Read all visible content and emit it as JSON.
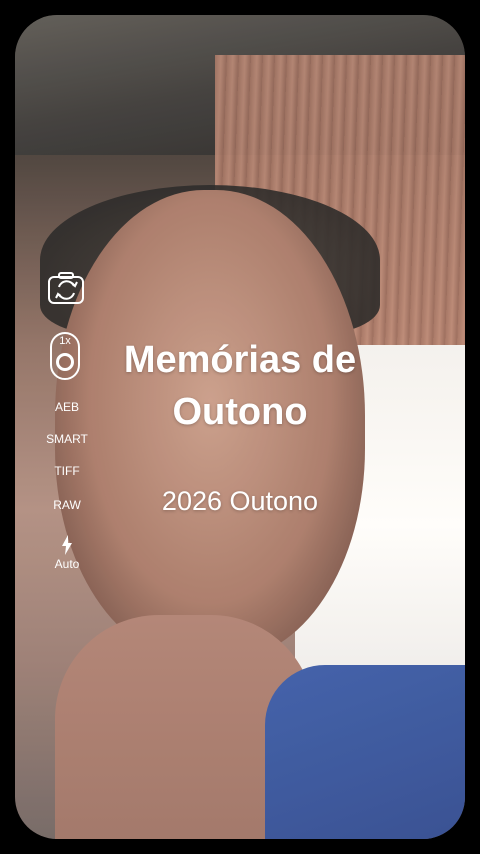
{
  "viewfinder": {
    "scene": "camera-preview"
  },
  "controls": {
    "camera_switch_icon": "camera-switch-icon",
    "lens": {
      "zoom": "1x",
      "icon": "lens-icon"
    },
    "options": [
      "AEB",
      "SMART",
      "TIFF",
      "RAW"
    ],
    "flash": {
      "icon": "flash-icon",
      "label": "Auto"
    }
  },
  "overlay": {
    "title_line1": "Memórias de",
    "title_line2": "Outono",
    "subtitle": "2026 Outono"
  },
  "colors": {
    "text": "#ffffff",
    "frame": "#000000"
  }
}
